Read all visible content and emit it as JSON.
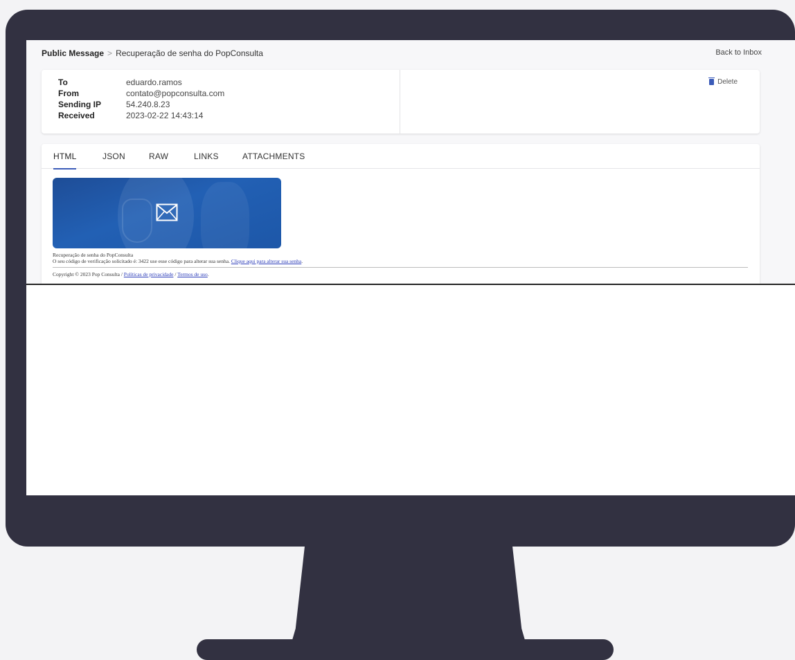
{
  "breadcrumb": {
    "root": "Public Message",
    "separator": ">",
    "current": "Recuperação de senha do PopConsulta"
  },
  "back_link": "Back to Inbox",
  "message": {
    "fields": [
      {
        "label": "To",
        "value": "eduardo.ramos"
      },
      {
        "label": "From",
        "value": "contato@popconsulta.com"
      },
      {
        "label": "Sending IP",
        "value": "54.240.8.23"
      },
      {
        "label": "Received",
        "value": "2023-02-22 14:43:14"
      }
    ],
    "delete_label": "Delete"
  },
  "tabs": [
    {
      "label": "HTML",
      "active": true
    },
    {
      "label": "JSON",
      "active": false
    },
    {
      "label": "RAW",
      "active": false
    },
    {
      "label": "LINKS",
      "active": false
    },
    {
      "label": "ATTACHMENTS",
      "active": false
    }
  ],
  "email": {
    "banner_icon": "envelope-icon",
    "title": "Recuperação de senha do PopConsulta",
    "body_prefix": "O seu código de verificação solicitado é: 3422 use esse código para alterar sua senha.",
    "body_link": "Clique aqui para alterar sua senha",
    "body_suffix": ".",
    "footer_prefix": "Copyright © 2023 Pop Consulta /",
    "footer_link_1": "Políticas de privacidade",
    "footer_sep": "/",
    "footer_link_2": "Termos de uso",
    "footer_suffix": "."
  },
  "colors": {
    "accent": "#3b5bb8",
    "monitor": "#323141",
    "banner": "#2260b4"
  }
}
